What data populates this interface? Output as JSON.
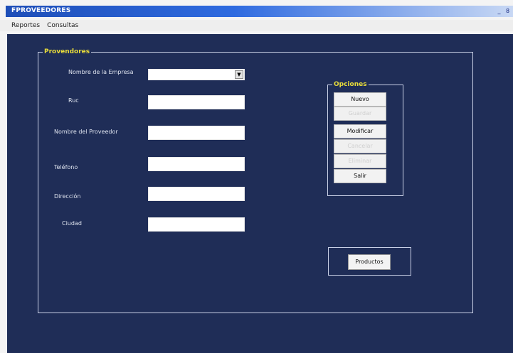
{
  "window": {
    "title": "FPROVEEDORES",
    "controls": [
      "_",
      "8"
    ]
  },
  "menu": [
    "Reportes",
    "Consultas"
  ],
  "proveedores": {
    "legend": "Provendores",
    "fields": [
      {
        "label": "Nombre de la Empresa",
        "value": ""
      },
      {
        "label": "Ruc",
        "value": ""
      },
      {
        "label": "Nombre del Proveedor",
        "value": ""
      },
      {
        "label": "Teléfono",
        "value": ""
      },
      {
        "label": "Dirección",
        "value": ""
      },
      {
        "label": "Ciudad",
        "value": ""
      }
    ]
  },
  "opciones": {
    "legend": "Opciones",
    "buttons": [
      {
        "label": "Nuevo",
        "enabled": true
      },
      {
        "label": "Guardar",
        "enabled": false
      },
      {
        "label": "Modificar",
        "enabled": true
      },
      {
        "label": "Cancelar",
        "enabled": false
      },
      {
        "label": "Eliminar",
        "enabled": false
      },
      {
        "label": "Salir",
        "enabled": true
      }
    ]
  },
  "productos_button": "Productos",
  "colors": {
    "background": "#1f2d57",
    "legend_text": "#e8dc3a",
    "titlebar": "#2f6be0"
  }
}
